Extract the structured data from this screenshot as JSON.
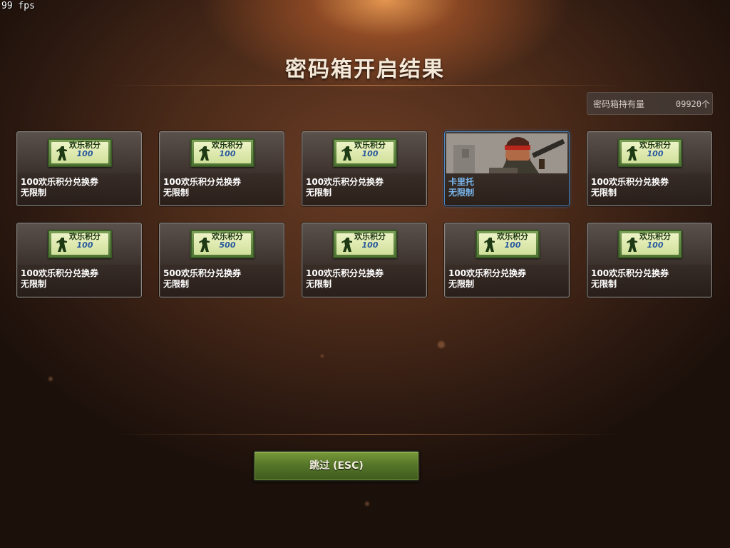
{
  "hud": {
    "fps": "99 fps"
  },
  "header": {
    "title": "密码箱开启结果"
  },
  "holdings": {
    "label": "密码箱持有量",
    "count": "09920个"
  },
  "rewards": [
    {
      "name": "100欢乐积分兑换券",
      "limit": "无限制",
      "coupon_title": "欢乐积分",
      "coupon_value": "100",
      "type": "coupon"
    },
    {
      "name": "100欢乐积分兑换券",
      "limit": "无限制",
      "coupon_title": "欢乐积分",
      "coupon_value": "100",
      "type": "coupon"
    },
    {
      "name": "100欢乐积分兑换券",
      "limit": "无限制",
      "coupon_title": "欢乐积分",
      "coupon_value": "100",
      "type": "coupon"
    },
    {
      "name": "卡里托",
      "limit": "无限制",
      "type": "character"
    },
    {
      "name": "100欢乐积分兑换券",
      "limit": "无限制",
      "coupon_title": "欢乐积分",
      "coupon_value": "100",
      "type": "coupon"
    },
    {
      "name": "100欢乐积分兑换券",
      "limit": "无限制",
      "coupon_title": "欢乐积分",
      "coupon_value": "100",
      "type": "coupon"
    },
    {
      "name": "500欢乐积分兑换券",
      "limit": "无限制",
      "coupon_title": "欢乐积分",
      "coupon_value": "500",
      "type": "coupon"
    },
    {
      "name": "100欢乐积分兑换券",
      "limit": "无限制",
      "coupon_title": "欢乐积分",
      "coupon_value": "100",
      "type": "coupon"
    },
    {
      "name": "100欢乐积分兑换券",
      "limit": "无限制",
      "coupon_title": "欢乐积分",
      "coupon_value": "100",
      "type": "coupon"
    },
    {
      "name": "100欢乐积分兑换券",
      "limit": "无限制",
      "coupon_title": "欢乐积分",
      "coupon_value": "100",
      "type": "coupon"
    }
  ],
  "footer": {
    "skip_label": "跳过 (ESC)"
  },
  "colors": {
    "hero_accent": "#79b7ee",
    "button_green": "#56762a",
    "coupon_green": "#4e7233"
  }
}
